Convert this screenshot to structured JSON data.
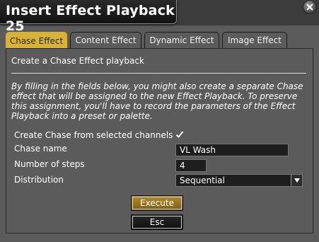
{
  "window": {
    "title": "Insert Effect Playback 25"
  },
  "tabs": [
    {
      "label": "Chase Effect",
      "active": true
    },
    {
      "label": "Content Effect",
      "active": false
    },
    {
      "label": "Dynamic Effect",
      "active": false
    },
    {
      "label": "Image Effect",
      "active": false
    }
  ],
  "panel": {
    "heading": "Create a Chase Effect playback",
    "note": "By filling in the fields below, you might also create a separate Chase effect that will be assigned to the new Effect Playback. To preserve this assignment, you'll have to record the parameters of the Effect Playback into a preset or palette."
  },
  "form": {
    "create_chase_label": "Create Chase from selected channels",
    "create_chase_checked": true,
    "chase_name_label": "Chase name",
    "chase_name_value": "VL Wash",
    "steps_label": "Number of steps",
    "steps_value": "4",
    "distribution_label": "Distribution",
    "distribution_value": "Sequential"
  },
  "buttons": {
    "execute": "Execute",
    "esc": "Esc"
  },
  "colors": {
    "accent": "#d9b23a",
    "execute_button": "#9a7620"
  },
  "icons": {
    "close": "close-icon",
    "check": "checkmark-icon",
    "dropdown": "chevron-down-icon"
  }
}
